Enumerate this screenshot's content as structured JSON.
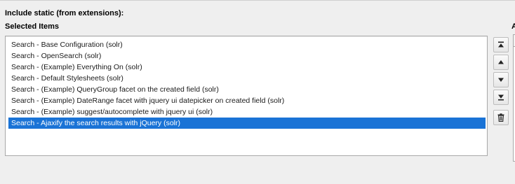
{
  "section": {
    "title": "Include static (from extensions):"
  },
  "selected": {
    "label": "Selected Items",
    "items": [
      "Search - Base Configuration (solr)",
      "Search - OpenSearch (solr)",
      "Search - (Example) Everything On (solr)",
      "Search - Default Stylesheets (solr)",
      "Search - (Example) QueryGroup facet on the created field (solr)",
      "Search - (Example) DateRange facet with jquery ui datepicker on created field (solr)",
      "Search - (Example) suggest/autocomplete with jquery ui (solr)",
      "Search - Ajaxify the search results with jQuery (solr)"
    ],
    "selected_index": 7
  },
  "available": {
    "label_visible": "A"
  },
  "controls": {
    "move_top": "move-to-top-icon",
    "move_up": "move-up-icon",
    "move_down": "move-down-icon",
    "move_bottom": "move-to-bottom-icon",
    "remove": "trash-icon"
  },
  "colors": {
    "selection": "#1a73d6",
    "background": "#efefef"
  }
}
